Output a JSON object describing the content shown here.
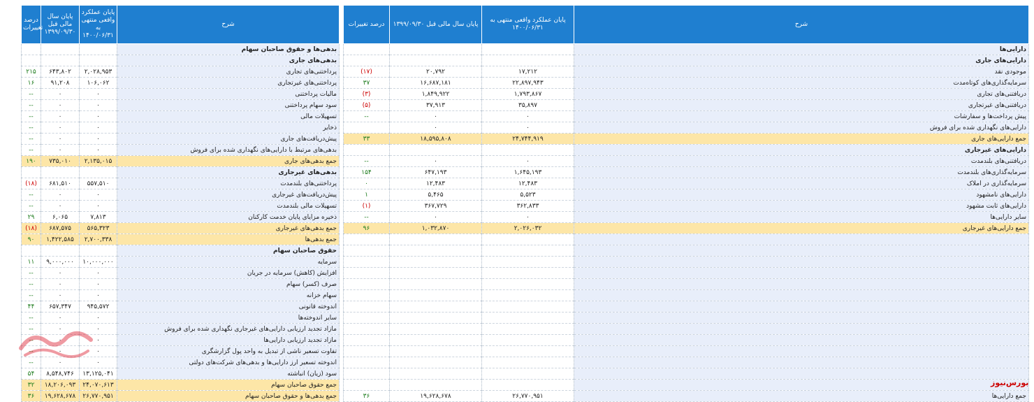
{
  "headers": {
    "desc": "شرح",
    "current": "پایان عملکرد واقعی منتهی به ۱۴۰۰/۰۶/۳۱",
    "prior": "پایان سال مالی قبل ۱۳۹۹/۰۹/۳۰",
    "change": "درصد تغییرات"
  },
  "assets": [
    {
      "d": "دارایی‌ها",
      "c": "",
      "p": "",
      "ch": "",
      "t": "sec"
    },
    {
      "d": "دارایی‌های جاری",
      "c": "",
      "p": "",
      "ch": "",
      "t": "sec"
    },
    {
      "d": "موجودی نقد",
      "c": "۱۷,۲۱۲",
      "p": "۲۰,۷۹۲",
      "ch": "(۱۷)",
      "t": ""
    },
    {
      "d": "سرمایه‌گذاری‌های کوتاه‌مدت",
      "c": "۲۲,۸۹۷,۹۴۳",
      "p": "۱۶,۶۸۷,۱۸۱",
      "ch": "۳۷",
      "t": ""
    },
    {
      "d": "دریافتنی‌های تجاری",
      "c": "۱,۷۹۳,۸۶۷",
      "p": "۱,۸۴۹,۹۲۲",
      "ch": "(۳)",
      "t": ""
    },
    {
      "d": "دریافتنی‌های غیرتجاری",
      "c": "۳۵,۸۹۷",
      "p": "۳۷,۹۱۳",
      "ch": "(۵)",
      "t": ""
    },
    {
      "d": "پیش پرداخت‌ها و سفارشات",
      "c": "۰",
      "p": "۰",
      "ch": "--",
      "t": ""
    },
    {
      "d": "دارایی‌های نگهداری شده برای فروش",
      "c": "۰",
      "p": "۰",
      "ch": "",
      "t": ""
    },
    {
      "d": "جمع دارایی‌های جاری",
      "c": "۲۴,۷۴۴,۹۱۹",
      "p": "۱۸,۵۹۵,۸۰۸",
      "ch": "۳۳",
      "t": "tot"
    },
    {
      "d": "دارایی‌های غیرجاری",
      "c": "",
      "p": "",
      "ch": "",
      "t": "sec"
    },
    {
      "d": "دریافتنی‌های بلندمدت",
      "c": "۰",
      "p": "۰",
      "ch": "--",
      "t": ""
    },
    {
      "d": "سرمایه‌گذاری‌های بلندمدت",
      "c": "۱,۶۴۵,۱۹۳",
      "p": "۶۴۷,۱۹۳",
      "ch": "۱۵۴",
      "t": ""
    },
    {
      "d": "سرمایه‌گذاری در املاک",
      "c": "۱۲,۴۸۳",
      "p": "۱۲,۴۸۳",
      "ch": "۰",
      "t": ""
    },
    {
      "d": "دارایی‌های نامشهود",
      "c": "۵,۵۲۳",
      "p": "۵,۴۶۵",
      "ch": "۱",
      "t": ""
    },
    {
      "d": "دارایی‌های ثابت مشهود",
      "c": "۳۶۲,۸۳۳",
      "p": "۳۶۷,۷۲۹",
      "ch": "(۱)",
      "t": ""
    },
    {
      "d": "سایر دارایی‌ها",
      "c": "۰",
      "p": "۰",
      "ch": "--",
      "t": ""
    },
    {
      "d": "جمع دارایی‌های غیرجاری",
      "c": "۲,۰۲۶,۰۳۲",
      "p": "۱,۰۳۲,۸۷۰",
      "ch": "۹۶",
      "t": "tot"
    },
    {
      "d": "",
      "c": "",
      "p": "",
      "ch": "",
      "t": ""
    },
    {
      "d": "",
      "c": "",
      "p": "",
      "ch": "",
      "t": ""
    },
    {
      "d": "",
      "c": "",
      "p": "",
      "ch": "",
      "t": ""
    },
    {
      "d": "",
      "c": "",
      "p": "",
      "ch": "",
      "t": ""
    },
    {
      "d": "",
      "c": "",
      "p": "",
      "ch": "",
      "t": ""
    },
    {
      "d": "",
      "c": "",
      "p": "",
      "ch": "",
      "t": ""
    },
    {
      "d": "",
      "c": "",
      "p": "",
      "ch": "",
      "t": ""
    },
    {
      "d": "",
      "c": "",
      "p": "",
      "ch": "",
      "t": ""
    },
    {
      "d": "",
      "c": "",
      "p": "",
      "ch": "",
      "t": ""
    },
    {
      "d": "",
      "c": "",
      "p": "",
      "ch": "",
      "t": ""
    },
    {
      "d": "",
      "c": "",
      "p": "",
      "ch": "",
      "t": ""
    },
    {
      "d": "",
      "c": "",
      "p": "",
      "ch": "",
      "t": ""
    },
    {
      "d": "",
      "c": "",
      "p": "",
      "ch": "",
      "t": ""
    },
    {
      "d": "",
      "c": "",
      "p": "",
      "ch": "",
      "t": ""
    },
    {
      "d": "جمع دارایی‌ها",
      "c": "۲۶,۷۷۰,۹۵۱",
      "p": "۱۹,۶۲۸,۶۷۸",
      "ch": "۳۶",
      "t": "gt"
    }
  ],
  "liabilities": [
    {
      "d": "بدهی‌ها و حقوق صاحبان سهام",
      "c": "",
      "p": "",
      "ch": "",
      "t": "sec"
    },
    {
      "d": "بدهی‌های جاری",
      "c": "",
      "p": "",
      "ch": "",
      "t": "sec"
    },
    {
      "d": "پرداختنی‌های تجاری",
      "c": "۲,۰۲۸,۹۵۳",
      "p": "۶۴۳,۸۰۲",
      "ch": "۲۱۵",
      "t": ""
    },
    {
      "d": "پرداختنی‌های غیرتجاری",
      "c": "۱۰۶,۰۶۲",
      "p": "۹۱,۲۰۸",
      "ch": "۱۶",
      "t": ""
    },
    {
      "d": "مالیات پرداختنی",
      "c": "۰",
      "p": "۰",
      "ch": "--",
      "t": ""
    },
    {
      "d": "سود سهام پرداختنی",
      "c": "۰",
      "p": "۰",
      "ch": "--",
      "t": ""
    },
    {
      "d": "تسهیلات مالی",
      "c": "۰",
      "p": "۰",
      "ch": "--",
      "t": ""
    },
    {
      "d": "ذخایر",
      "c": "۰",
      "p": "۰",
      "ch": "--",
      "t": ""
    },
    {
      "d": "پیش‌دریافت‌های جاری",
      "c": "۰",
      "p": "۰",
      "ch": "--",
      "t": ""
    },
    {
      "d": "بدهی‌های مرتبط با دارایی‌های نگهداری شده برای فروش",
      "c": "۰",
      "p": "۰",
      "ch": "--",
      "t": ""
    },
    {
      "d": "جمع بدهی‌های جاری",
      "c": "۲,۱۳۵,۰۱۵",
      "p": "۷۳۵,۰۱۰",
      "ch": "۱۹۰",
      "t": "tot"
    },
    {
      "d": "بدهی‌های غیرجاری",
      "c": "",
      "p": "",
      "ch": "",
      "t": "sec"
    },
    {
      "d": "پرداختنی‌های بلندمدت",
      "c": "۵۵۷,۵۱۰",
      "p": "۶۸۱,۵۱۰",
      "ch": "(۱۸)",
      "t": ""
    },
    {
      "d": "پیش‌دریافت‌های غیرجاری",
      "c": "۰",
      "p": "۰",
      "ch": "--",
      "t": ""
    },
    {
      "d": "تسهیلات مالی بلندمدت",
      "c": "۰",
      "p": "۰",
      "ch": "--",
      "t": ""
    },
    {
      "d": "ذخیره مزایای پایان خدمت کارکنان",
      "c": "۷,۸۱۳",
      "p": "۶,۰۶۵",
      "ch": "۲۹",
      "t": ""
    },
    {
      "d": "جمع بدهی‌های غیرجاری",
      "c": "۵۶۵,۳۲۳",
      "p": "۶۸۷,۵۷۵",
      "ch": "(۱۸)",
      "t": "tot"
    },
    {
      "d": "جمع بدهی‌ها",
      "c": "۲,۷۰۰,۳۳۸",
      "p": "۱,۴۲۲,۵۸۵",
      "ch": "۹۰",
      "t": "tot"
    },
    {
      "d": "حقوق صاحبان سهام",
      "c": "",
      "p": "",
      "ch": "",
      "t": "sec"
    },
    {
      "d": "سرمایه",
      "c": "۱۰,۰۰۰,۰۰۰",
      "p": "۹,۰۰۰,۰۰۰",
      "ch": "۱۱",
      "t": ""
    },
    {
      "d": "افزایش (کاهش) سرمایه در جریان",
      "c": "۰",
      "p": "۰",
      "ch": "--",
      "t": ""
    },
    {
      "d": "صرف (کسر) سهام",
      "c": "۰",
      "p": "۰",
      "ch": "--",
      "t": ""
    },
    {
      "d": "سهام خزانه",
      "c": "۰",
      "p": "۰",
      "ch": "--",
      "t": ""
    },
    {
      "d": "اندوخته قانونی",
      "c": "۹۴۵,۵۷۲",
      "p": "۶۵۷,۳۴۷",
      "ch": "۴۴",
      "t": ""
    },
    {
      "d": "سایر اندوخته‌ها",
      "c": "۰",
      "p": "۰",
      "ch": "--",
      "t": ""
    },
    {
      "d": "مازاد تجدید ارزیابی دارایی‌های غیرجاری نگهداری شده برای فروش",
      "c": "۰",
      "p": "۰",
      "ch": "--",
      "t": ""
    },
    {
      "d": "مازاد تجدید ارزیابی دارایی‌ها",
      "c": "۰",
      "p": "۰",
      "ch": "--",
      "t": ""
    },
    {
      "d": "تفاوت تسعیر ناشی از تبدیل به واحد پول گزارشگری",
      "c": "۰",
      "p": "۰",
      "ch": "--",
      "t": ""
    },
    {
      "d": "اندوخته تسعیر ارز دارایی‌ها و بدهی‌های شرکت‌های دولتی",
      "c": "۰",
      "p": "۰",
      "ch": "--",
      "t": ""
    },
    {
      "d": "سود (زیان) انباشته",
      "c": "۱۳,۱۲۵,۰۴۱",
      "p": "۸,۵۴۸,۷۴۶",
      "ch": "۵۴",
      "t": ""
    },
    {
      "d": "جمع حقوق صاحبان سهام",
      "c": "۲۴,۰۷۰,۶۱۳",
      "p": "۱۸,۲۰۶,۰۹۳",
      "ch": "۳۲",
      "t": "tot"
    },
    {
      "d": "جمع بدهی‌ها و حقوق صاحبان سهام",
      "c": "۲۶,۷۷۰,۹۵۱",
      "p": "۱۹,۶۲۸,۶۷۸",
      "ch": "۳۶",
      "t": "tot"
    }
  ],
  "watermark_text": "بورس نیوز",
  "brand_text": "بورس‌نیوز",
  "colors": {
    "header": "#1f7fd0",
    "total_row": "#fde6a7",
    "desc_bg": "#e8eefa",
    "negative": "#cc0000",
    "positive": "#1a7a1a"
  }
}
